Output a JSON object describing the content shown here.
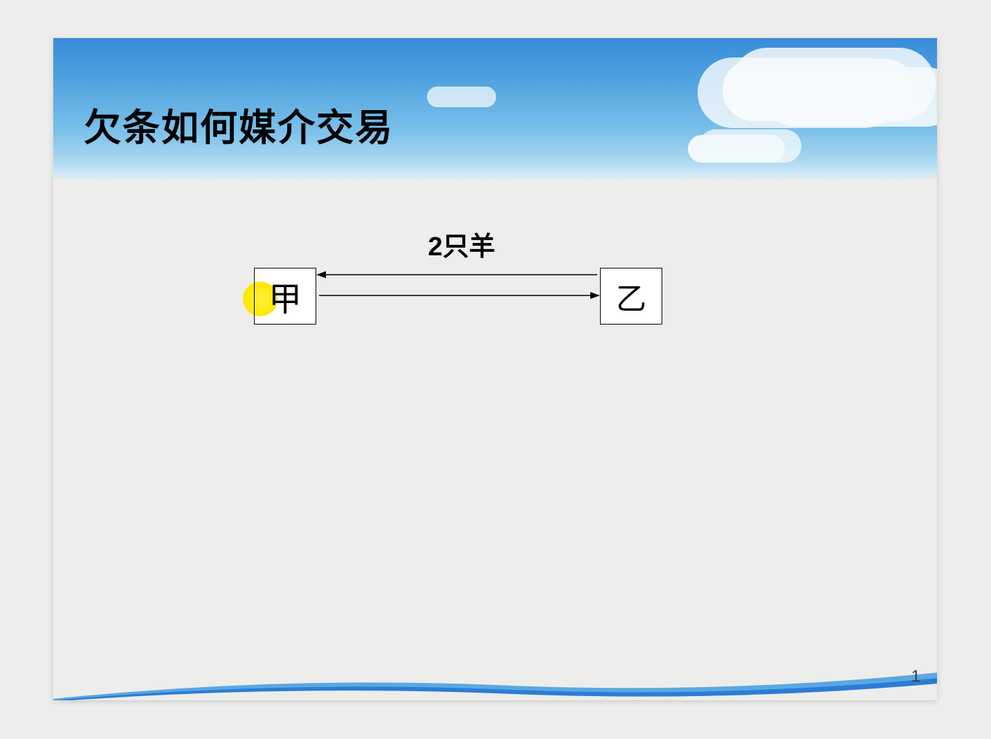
{
  "slide": {
    "title": "欠条如何媒介交易",
    "page_number": "1"
  },
  "diagram": {
    "node_a": "甲",
    "node_b": "乙",
    "arrow_label": "2只羊"
  },
  "colors": {
    "sky_top": "#3a8bd8",
    "sky_bottom": "#cce8f7",
    "highlight": "#ffe600",
    "footer_curve": "#2b7dd4",
    "background": "#ededeb"
  }
}
